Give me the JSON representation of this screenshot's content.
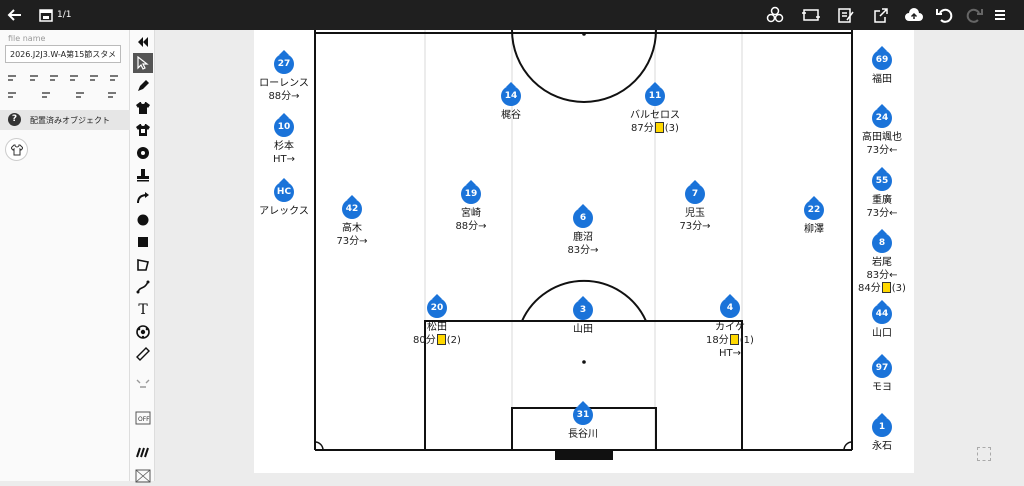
{
  "topbar": {
    "page_count": "1/1",
    "icons": [
      "back-arrow-icon",
      "calendar-icon",
      "share-tactics-icon",
      "swap-icon",
      "edit-icon",
      "export-icon",
      "cloud-upload-icon",
      "undo-icon",
      "redo-icon",
      "menu-icon"
    ]
  },
  "left_panel": {
    "file_name_label": "file name",
    "file_name_value": "2026.J2J3.W-A第15節スタメ",
    "placed_objects_label": "配置済みオブジェクト"
  },
  "toolbar": {
    "tools": [
      "collapse-icon",
      "select-icon",
      "pen-icon",
      "shirt-dark-icon",
      "shirt-number-icon",
      "ball-icon",
      "stamp-icon",
      "arrow-curve-icon",
      "circle-icon",
      "square-icon",
      "polygon-icon",
      "line-icon",
      "text-icon",
      "soccer-ball-icon",
      "ruler-icon",
      "formation-icon",
      "offside-icon",
      "wall-icon",
      "pitch-icon"
    ]
  },
  "colors": {
    "player_pin": "#1a73d9",
    "yellow_card": "#ffd800"
  },
  "players": [
    {
      "number": "27",
      "name": "ローレンス",
      "note": "88分→"
    },
    {
      "number": "10",
      "name": "杉本",
      "note": "HT→"
    },
    {
      "number": "HC",
      "name": "アレックス",
      "note": ""
    },
    {
      "number": "42",
      "name": "高木",
      "note": "73分→"
    },
    {
      "number": "14",
      "name": "梶谷",
      "note": ""
    },
    {
      "number": "11",
      "name": "バルセロス",
      "note": "87分",
      "card": "(3)"
    },
    {
      "number": "19",
      "name": "宮崎",
      "note": "88分→"
    },
    {
      "number": "6",
      "name": "鹿沼",
      "note": "83分→"
    },
    {
      "number": "7",
      "name": "児玉",
      "note": "73分→"
    },
    {
      "number": "22",
      "name": "柳澤",
      "note": ""
    },
    {
      "number": "20",
      "name": "松田",
      "note": "80分",
      "card": "(2)"
    },
    {
      "number": "3",
      "name": "山田",
      "note": ""
    },
    {
      "number": "4",
      "name": "カイケ",
      "note": "18分",
      "card": "(1)",
      "note2": "HT→"
    },
    {
      "number": "31",
      "name": "長谷川",
      "note": ""
    },
    {
      "number": "69",
      "name": "福田",
      "note": ""
    },
    {
      "number": "24",
      "name": "高田颯也",
      "note": "73分←"
    },
    {
      "number": "55",
      "name": "重廣",
      "note": "73分←"
    },
    {
      "number": "8",
      "name": "岩尾",
      "note": "83分←",
      "note2": "84分",
      "card": "(3)"
    },
    {
      "number": "44",
      "name": "山口",
      "note": ""
    },
    {
      "number": "97",
      "name": "モヨ",
      "note": ""
    },
    {
      "number": "1",
      "name": "永石",
      "note": ""
    }
  ]
}
